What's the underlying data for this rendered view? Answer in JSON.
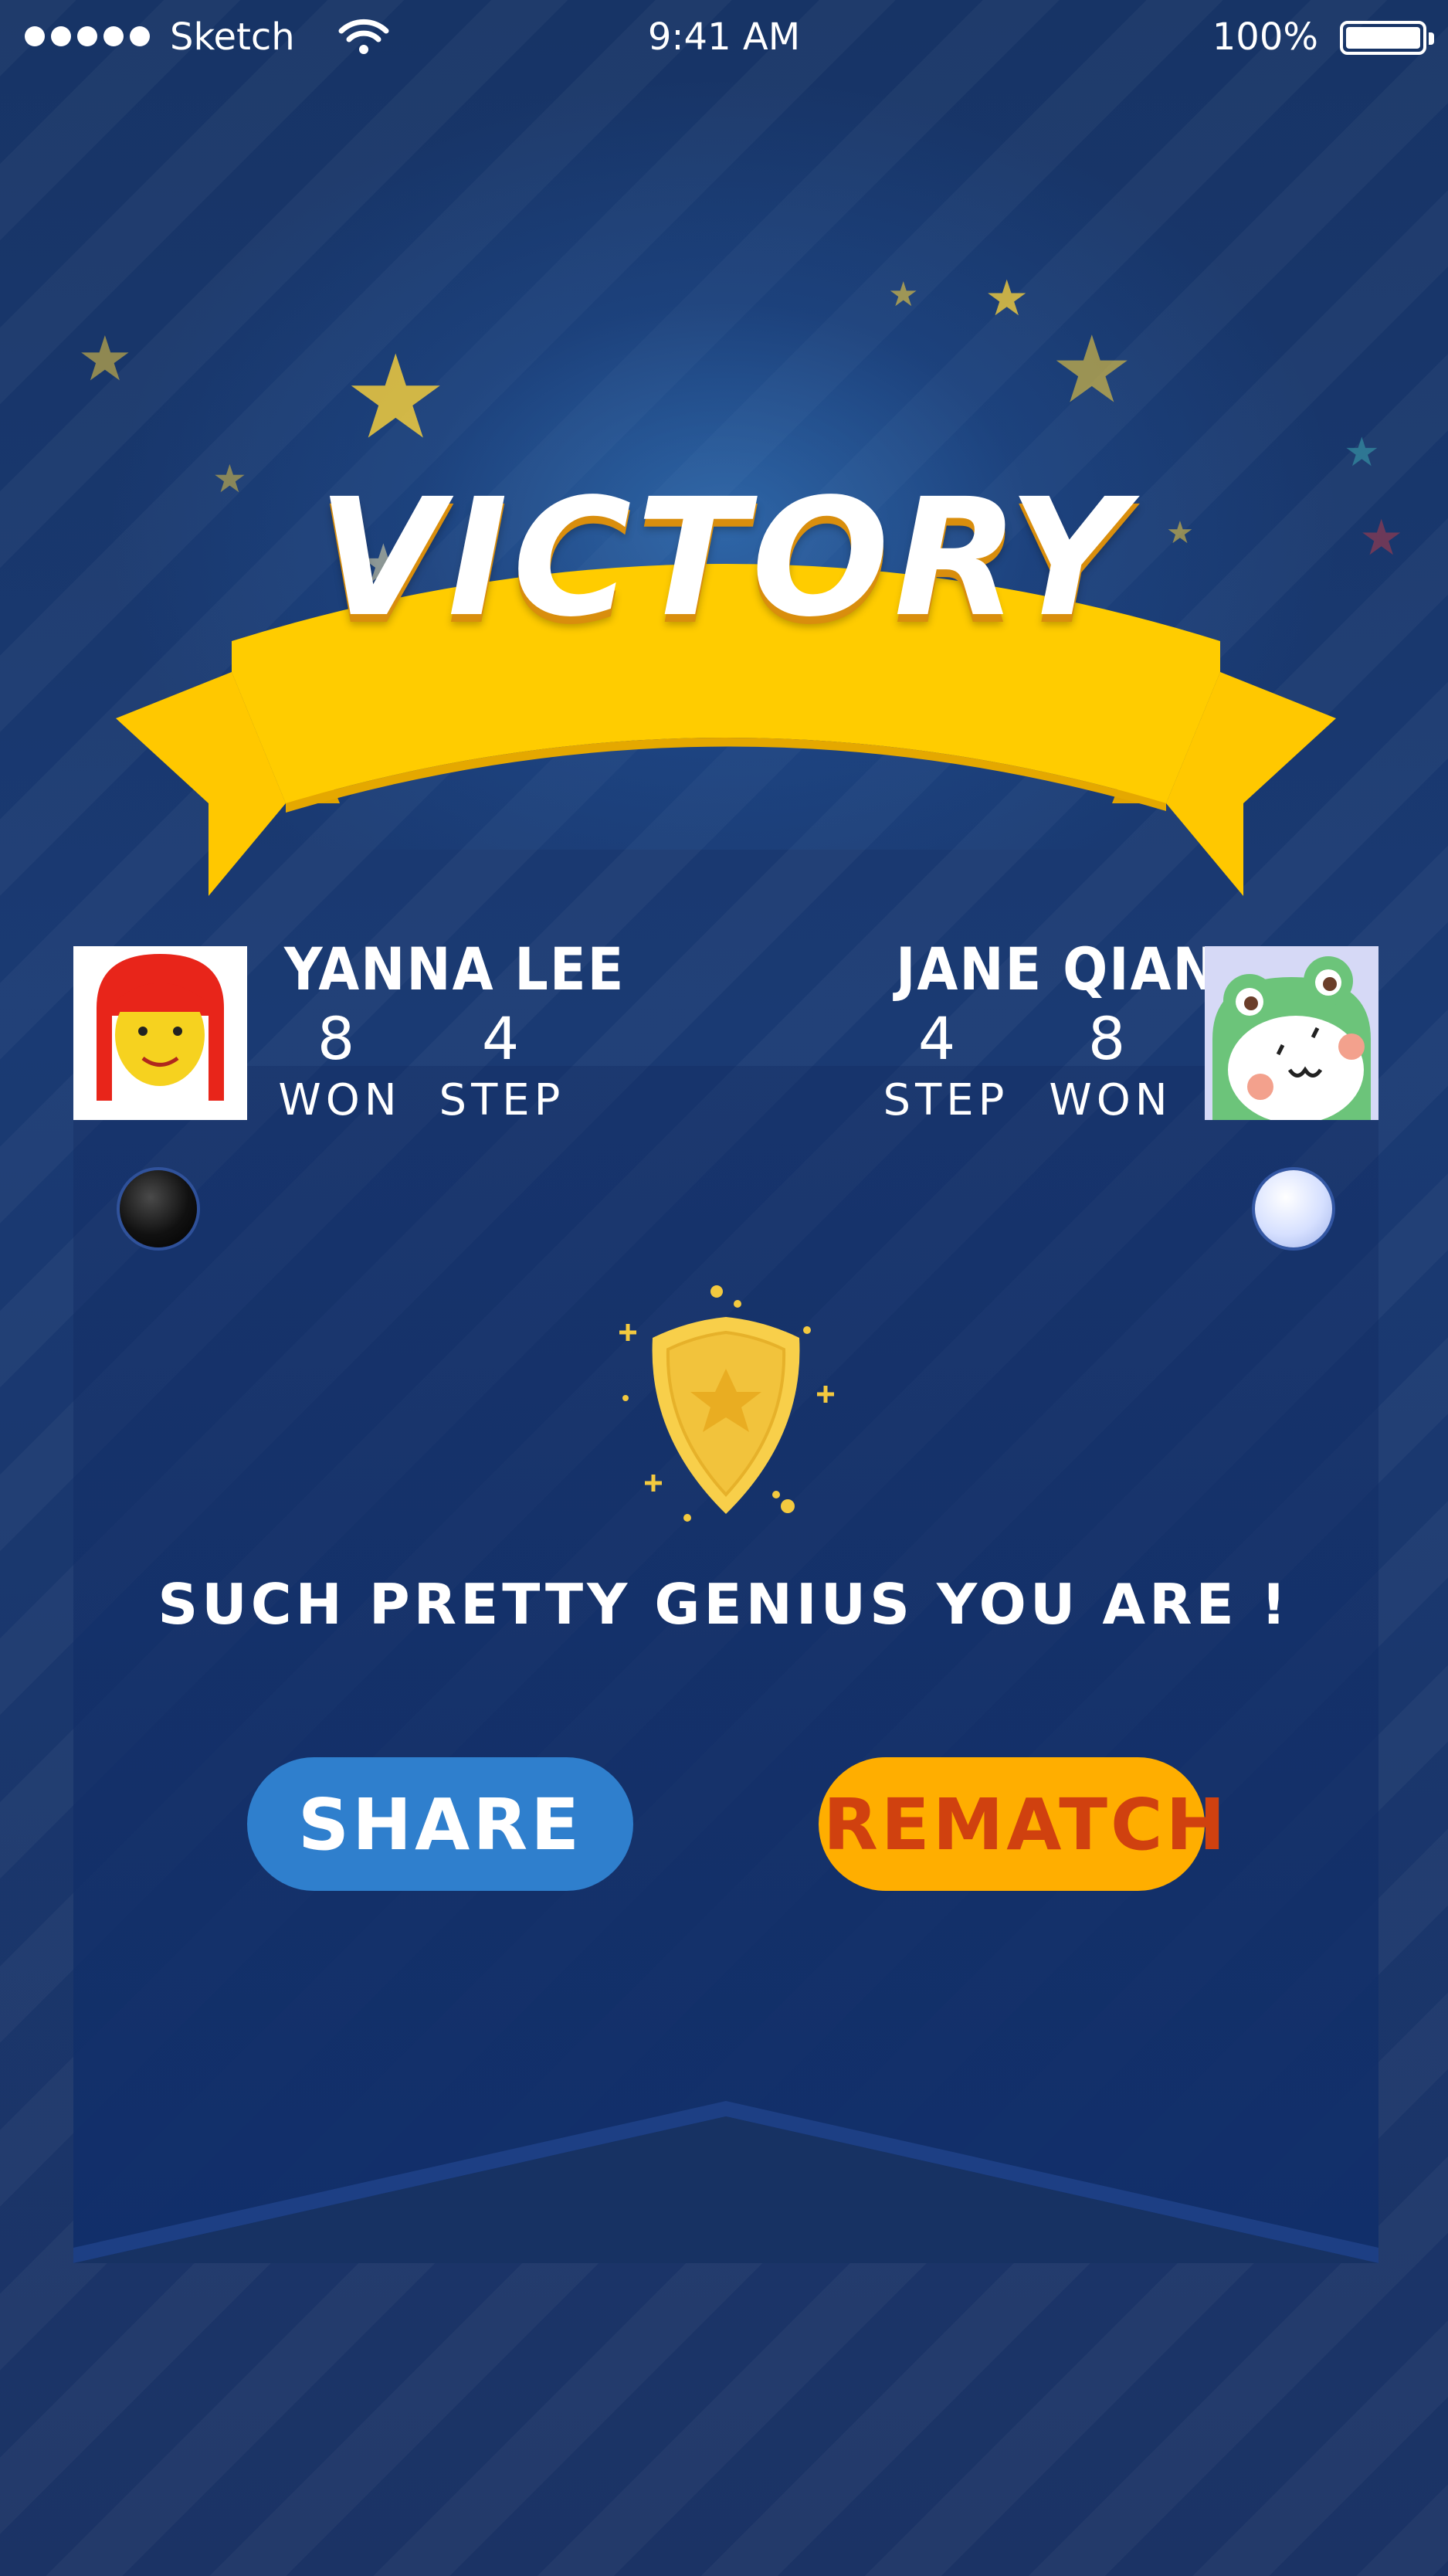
{
  "status_bar": {
    "carrier": "Sketch",
    "time": "9:41 AM",
    "battery": "100%"
  },
  "title": "VICTORY",
  "players": {
    "left": {
      "name": "YANNA LEE",
      "won_value": "8",
      "won_label": "WON",
      "step_value": "4",
      "step_label": "STEP",
      "stone": "black"
    },
    "right": {
      "name": "JANE QIAN",
      "step_value": "4",
      "step_label": "STEP",
      "won_value": "8",
      "won_label": "WON",
      "stone": "white"
    }
  },
  "badge_icon": "shield-star-icon",
  "message": "SUCH PRETTY GENIUS YOU ARE !",
  "buttons": {
    "share": "SHARE",
    "rematch": "REMATCH"
  },
  "colors": {
    "background": "#173263",
    "banner": "#ffcc00",
    "share_button": "#2f7fcd",
    "rematch_button": "#ffae00",
    "rematch_text": "#d0410f"
  }
}
